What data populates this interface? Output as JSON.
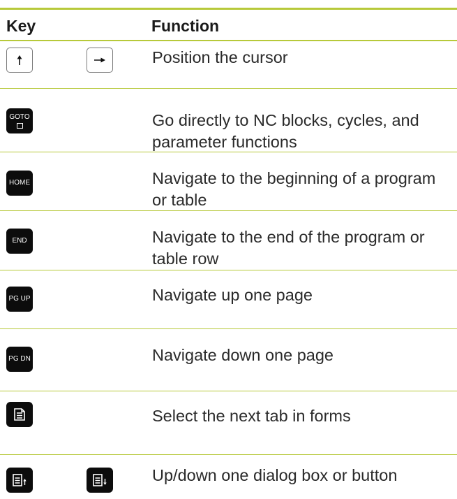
{
  "table": {
    "header": {
      "key": "Key",
      "function": "Function"
    },
    "rows": [
      {
        "keys": [
          "up-arrow-icon",
          "right-arrow-icon"
        ],
        "function": "Position the cursor"
      },
      {
        "keys": [
          "GOTO"
        ],
        "function": "Go directly to NC blocks, cycles, and parameter functions"
      },
      {
        "keys": [
          "HOME"
        ],
        "function": "Navigate to the beginning of a program or table"
      },
      {
        "keys": [
          "END"
        ],
        "function": "Navigate to the end of the program or table row"
      },
      {
        "keys": [
          "PG UP"
        ],
        "function": "Navigate up one page"
      },
      {
        "keys": [
          "PG DN"
        ],
        "function": "Navigate down one page"
      },
      {
        "keys": [
          "form-tab-icon"
        ],
        "function": "Select the next tab in forms"
      },
      {
        "keys": [
          "dialog-up-icon",
          "dialog-down-icon"
        ],
        "function": "Up/down one dialog box or button"
      }
    ]
  },
  "colors": {
    "rule": "#b7c93a",
    "key_black": "#0c0c0c",
    "text": "#2a2a2a"
  }
}
